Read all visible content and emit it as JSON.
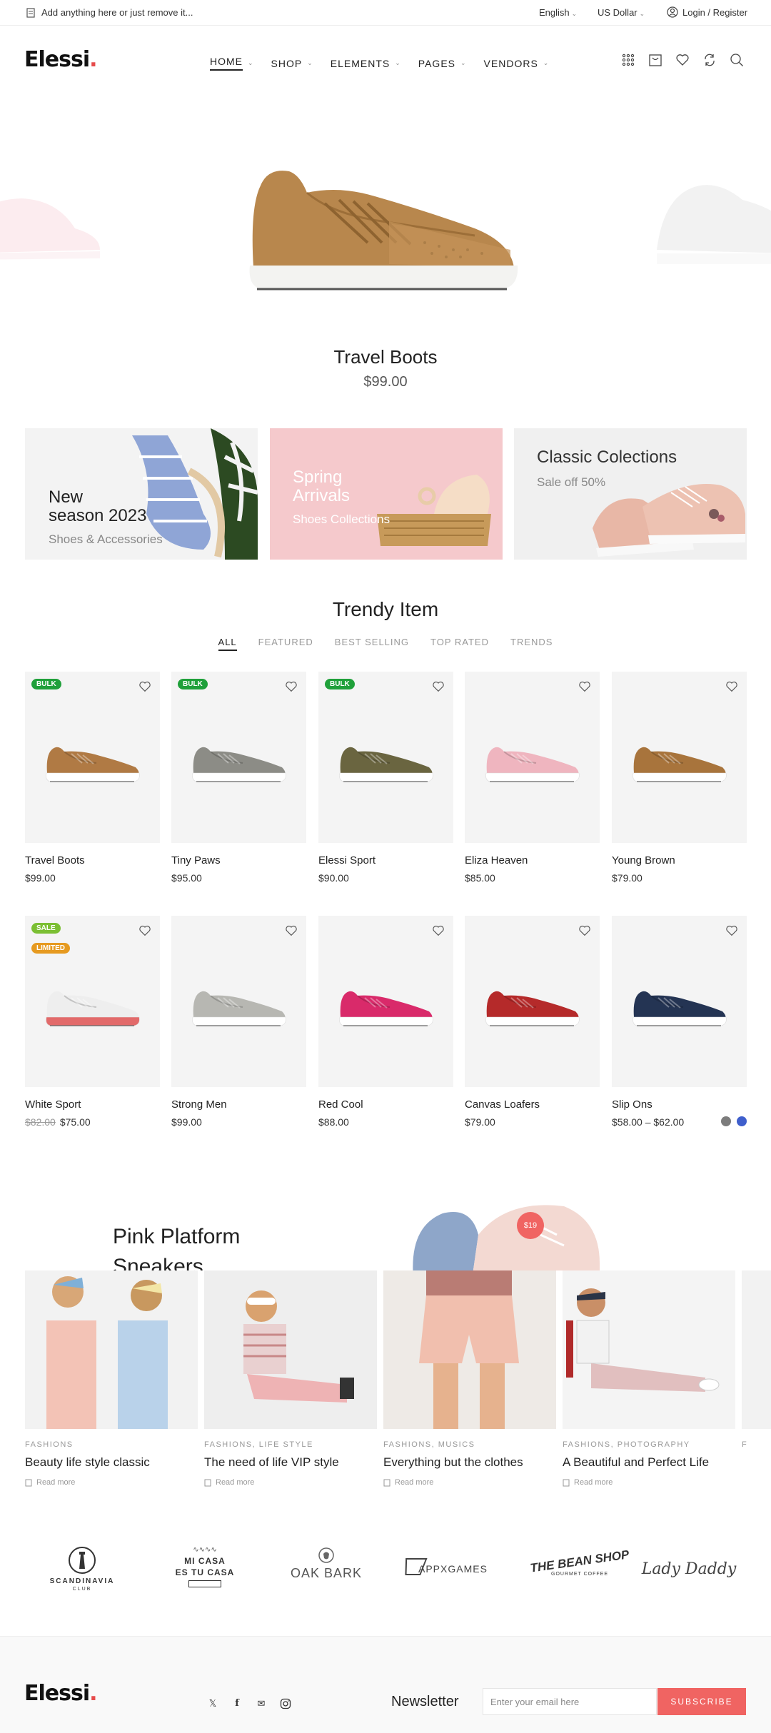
{
  "topbar": {
    "notice": "Add anything here or just remove it...",
    "language": "English",
    "currency": "US Dollar",
    "login": "Login / Register"
  },
  "header": {
    "logo": "Elessi",
    "nav": [
      "HOME",
      "SHOP",
      "ELEMENTS",
      "PAGES",
      "VENDORS"
    ]
  },
  "hero": {
    "title": "Travel Boots",
    "price": "$99.00"
  },
  "banners": [
    {
      "title_line1": "New",
      "title_line2": "season 2023",
      "subtitle": "Shoes & Accessories"
    },
    {
      "title_line1": "Spring",
      "title_line2": "Arrivals",
      "subtitle": "Shoes Collections"
    },
    {
      "title": "Classic Colections",
      "subtitle": "Sale off 50%"
    }
  ],
  "trendy": {
    "title": "Trendy Item",
    "tabs": [
      "ALL",
      "FEATURED",
      "BEST SELLING",
      "TOP RATED",
      "TRENDS"
    ],
    "products": [
      {
        "name": "Travel Boots",
        "price": "$99.00",
        "badge": "BULK",
        "color": "#b07a44"
      },
      {
        "name": "Tiny Paws",
        "price": "$95.00",
        "badge": "BULK",
        "color": "#8c8c86"
      },
      {
        "name": "Elessi Sport",
        "price": "$90.00",
        "badge": "BULK",
        "color": "#6a6540"
      },
      {
        "name": "Eliza Heaven",
        "price": "$85.00",
        "badge": "",
        "color": "#efb5bf"
      },
      {
        "name": "Young Brown",
        "price": "$79.00",
        "badge": "",
        "color": "#a8743c"
      },
      {
        "name": "White Sport",
        "price": "$75.00",
        "old_price": "$82.00",
        "badge": "SALE",
        "badge2": "LIMITED",
        "color": "#eeeeee"
      },
      {
        "name": "Strong Men",
        "price": "$99.00",
        "badge": "",
        "color": "#b7b7b2"
      },
      {
        "name": "Red Cool",
        "price": "$88.00",
        "badge": "",
        "color": "#d92a6a"
      },
      {
        "name": "Canvas Loafers",
        "price": "$79.00",
        "badge": "",
        "color": "#b52a2a"
      },
      {
        "name": "Slip Ons",
        "price": "$58.00 – $62.00",
        "badge": "",
        "color": "#243453"
      }
    ],
    "swatches": [
      "#7c7c7c",
      "#3f5fcc"
    ]
  },
  "promo": {
    "title_line1": "Pink Platform",
    "title_line2": "Sneakers",
    "badge": "$19"
  },
  "blog": [
    {
      "category": "FASHIONS",
      "title": "Beauty life style classic",
      "more": "Read more"
    },
    {
      "category": "FASHIONS, LIFE STYLE",
      "title": "The need of life VIP style",
      "more": "Read more"
    },
    {
      "category": "FASHIONS, MUSICS",
      "title": "Everything but the clothes",
      "more": "Read more"
    },
    {
      "category": "FASHIONS, PHOTOGRAPHY",
      "title": "A Beautiful and Perfect Life",
      "more": "Read more"
    }
  ],
  "brands": [
    {
      "name": "SCANDINAVIA",
      "sub": "CLUB"
    },
    {
      "name": "MI CASA",
      "sub": "ES TU CASA"
    },
    {
      "name": "OAK BARK",
      "sub": ""
    },
    {
      "name": "APPXGAMES",
      "sub": ""
    },
    {
      "name": "THE BEAN SHOP",
      "sub": "GOURMET COFFEE"
    },
    {
      "name": "Lady Daddy",
      "sub": ""
    }
  ],
  "footer": {
    "logo": "Elessi",
    "newsletter": "Newsletter",
    "email_placeholder": "Enter your email here",
    "subscribe": "SUBSCRIBE"
  }
}
